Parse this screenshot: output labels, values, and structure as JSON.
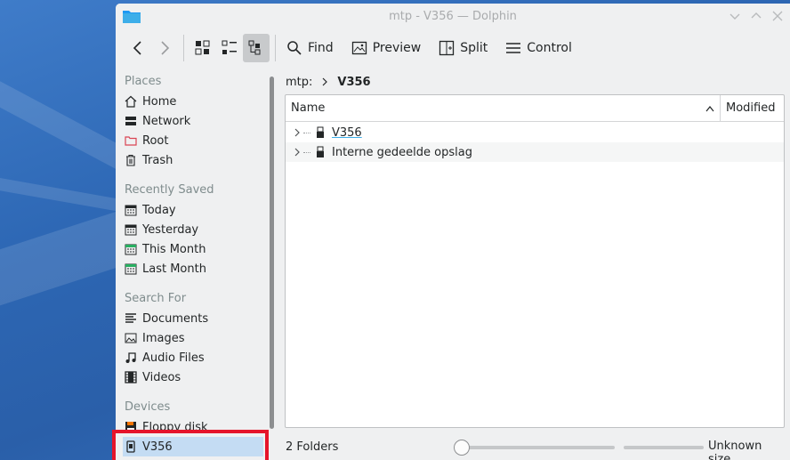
{
  "window": {
    "title": "mtp - V356 — Dolphin"
  },
  "toolbar": {
    "back_icon": "chevron-left-icon",
    "forward_icon": "chevron-right-icon",
    "find_label": "Find",
    "preview_label": "Preview",
    "split_label": "Split",
    "control_label": "Control"
  },
  "sidebar": {
    "sections": {
      "places": "Places",
      "recent": "Recently Saved",
      "search": "Search For",
      "devices": "Devices"
    },
    "places": [
      {
        "label": "Home",
        "icon": "home-icon"
      },
      {
        "label": "Network",
        "icon": "network-icon"
      },
      {
        "label": "Root",
        "icon": "root-folder-icon"
      },
      {
        "label": "Trash",
        "icon": "trash-icon"
      }
    ],
    "recent": [
      {
        "label": "Today",
        "icon": "calendar-icon"
      },
      {
        "label": "Yesterday",
        "icon": "calendar-icon"
      },
      {
        "label": "This Month",
        "icon": "calendar-icon"
      },
      {
        "label": "Last Month",
        "icon": "calendar-icon"
      }
    ],
    "search": [
      {
        "label": "Documents",
        "icon": "document-icon"
      },
      {
        "label": "Images",
        "icon": "image-icon"
      },
      {
        "label": "Audio Files",
        "icon": "music-icon"
      },
      {
        "label": "Videos",
        "icon": "film-icon"
      }
    ],
    "devices": [
      {
        "label": "Floppy disk",
        "icon": "floppy-icon"
      },
      {
        "label": "V356",
        "icon": "phone-icon"
      }
    ]
  },
  "breadcrumb": {
    "root": "mtp:",
    "current": "V356"
  },
  "columns": {
    "name": "Name",
    "modified": "Modified"
  },
  "files": [
    {
      "name": "V356",
      "icon": "usb-icon"
    },
    {
      "name": "Interne gedeelde opslag",
      "icon": "usb-icon"
    }
  ],
  "status": {
    "folders": "2 Folders",
    "size": "Unknown size"
  },
  "colors": {
    "accent": "#3daee9",
    "selection": "#c4dcf3",
    "highlight_box": "#e5142a"
  }
}
